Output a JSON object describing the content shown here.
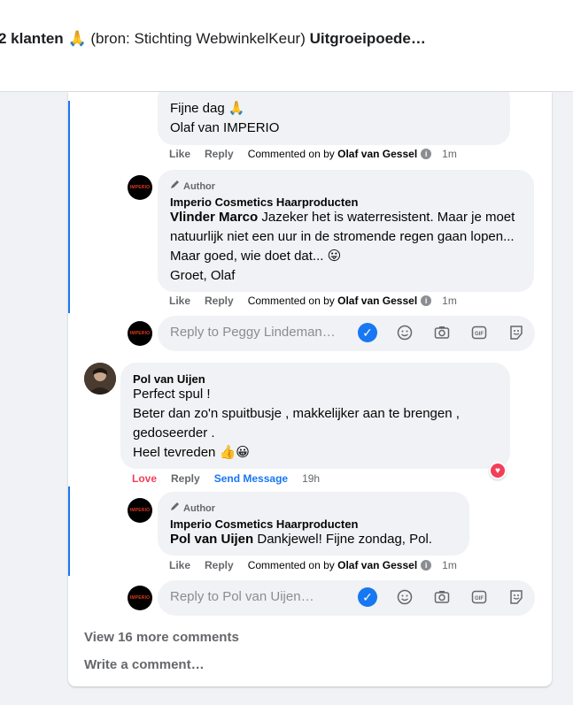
{
  "header": {
    "title_part1": "2 klanten",
    "title_part2": "(bron: Stichting WebwinkelKeur)",
    "title_part3": "Uitgroeipoede…"
  },
  "comments": {
    "c1": {
      "text_line1": "Fijne dag 🙏",
      "text_line2": "Olaf van IMPERIO",
      "like": "Like",
      "reply": "Reply",
      "commented_by": "Commented on by",
      "by_name": "Olaf van Gessel",
      "time": "1m"
    },
    "c2": {
      "author_badge": "Author",
      "name": "Imperio Cosmetics Haarproducten",
      "tag": "Vlinder Marco",
      "text": " Jazeker het is waterresistent. Maar je moet natuurlijk niet een uur in de stromende regen gaan lopen... Maar goed, wie doet dat... 😛\nGroet, Olaf",
      "like": "Like",
      "reply": "Reply",
      "commented_by": "Commented on by",
      "by_name": "Olaf van Gessel",
      "time": "1m"
    },
    "reply1": {
      "placeholder": "Reply to Peggy Lindeman…"
    },
    "c3": {
      "name": "Pol van Uijen",
      "text": "Perfect spul !\nBeter dan zo'n spuitbusje , makkelijker aan te brengen , gedoseerder .\nHeel tevreden 👍😀",
      "love": "Love",
      "reply": "Reply",
      "send_message": "Send Message",
      "time": "19h"
    },
    "c4": {
      "author_badge": "Author",
      "name": "Imperio Cosmetics Haarproducten",
      "tag": "Pol van Uijen",
      "text": " Dankjewel! Fijne zondag, Pol.",
      "like": "Like",
      "reply": "Reply",
      "commented_by": "Commented on by",
      "by_name": "Olaf van Gessel",
      "time": "1m"
    },
    "reply2": {
      "placeholder": "Reply to Pol van Uijen…"
    }
  },
  "footer": {
    "view_more": "View 16 more comments",
    "write": "Write a comment…"
  },
  "avatar_text": "IMPERIO",
  "colors": {
    "accent": "#1877f2",
    "love": "#f33e58"
  }
}
